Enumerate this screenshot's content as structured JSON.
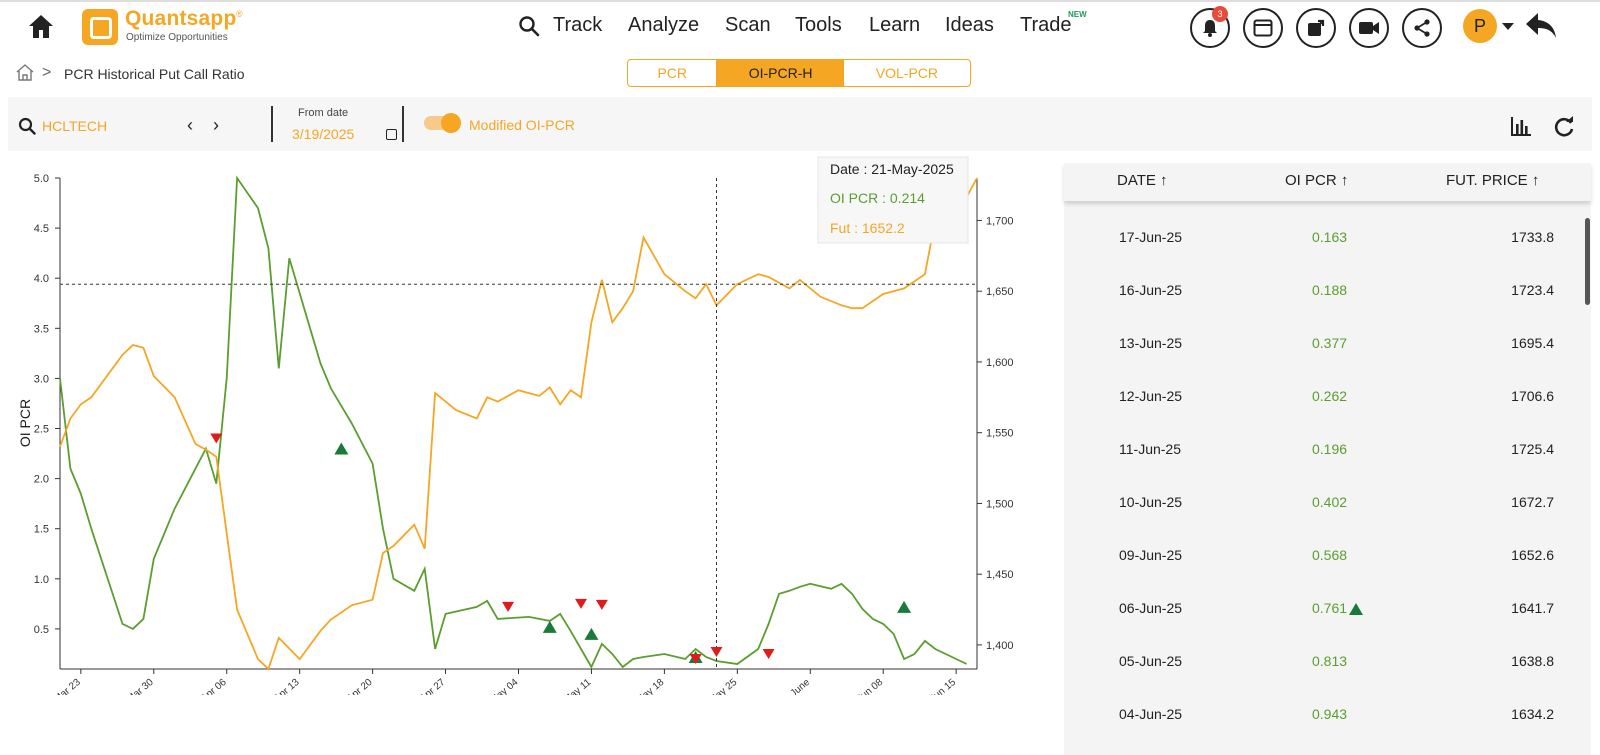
{
  "brand": {
    "title": "Quantsapp",
    "registered": "®",
    "tagline": "Optimize Opportunities"
  },
  "nav": {
    "items": [
      "Track",
      "Analyze",
      "Scan",
      "Tools",
      "Learn",
      "Ideas",
      "Trade"
    ],
    "new_badge": "NEW",
    "notification_count": "3",
    "avatar_letter": "P"
  },
  "breadcrumb": {
    "page": "PCR Historical Put Call Ratio",
    "separator": ">"
  },
  "tabs": [
    {
      "label": "PCR",
      "active": false
    },
    {
      "label": "OI-PCR-H",
      "active": true
    },
    {
      "label": "VOL-PCR",
      "active": false
    }
  ],
  "toolbar": {
    "symbol": "HCLTECH",
    "prev": "‹",
    "next": "›",
    "from_date_label": "From date",
    "from_date": "3/19/2025",
    "toggle_label": "Modified OI-PCR",
    "toggle_on": true
  },
  "tooltip": {
    "date": "Date : 21-May-2025",
    "oi_pcr": "OI PCR : 0.214",
    "fut": "Fut : 1652.2"
  },
  "colors": {
    "accent": "#f5a623",
    "pcr_line": "#5a9e2f",
    "buy_signal": "#1a7a3a",
    "sell_signal": "#e01b1b"
  },
  "chart_data": {
    "type": "line",
    "ylabel": "OI PCR",
    "left_ylim": [
      0.1,
      5.0
    ],
    "right_ylim": [
      1383,
      1730
    ],
    "left_ticks": [
      "5.0",
      "4.5",
      "4.0",
      "3.5",
      "3.0",
      "2.5",
      "2.0",
      "1.5",
      "1.0",
      "0.5"
    ],
    "right_ticks": [
      "1,700",
      "1,650",
      "1,600",
      "1,550",
      "1,500",
      "1,450",
      "1,400"
    ],
    "x_ticks": [
      "Mar 23",
      "Mar 30",
      "Apr 06",
      "Apr 13",
      "Apr 20",
      "Apr 27",
      "May 04",
      "May 11",
      "May 18",
      "May 25",
      "June",
      "Jun 08",
      "Jun 15"
    ],
    "x_tick_days": [
      0,
      7,
      14,
      21,
      28,
      35,
      42,
      49,
      56,
      63,
      70,
      77,
      84
    ],
    "x_range_days": [
      -2,
      86
    ],
    "series": [
      {
        "name": "OI PCR",
        "axis": "left",
        "days": [
          -2,
          -1,
          0,
          1,
          4,
          5,
          6,
          7,
          9,
          11,
          12,
          13,
          14,
          15,
          17,
          18,
          19,
          20,
          23,
          24,
          26,
          28,
          29,
          30,
          32,
          33,
          34,
          35,
          38,
          39,
          40,
          43,
          44,
          45,
          46,
          47,
          48,
          49,
          50,
          51,
          52,
          53,
          54,
          56,
          58,
          59,
          60,
          61,
          63,
          65,
          66,
          67,
          68,
          69,
          70,
          72,
          73,
          74,
          75,
          76,
          77,
          78,
          79,
          80,
          81,
          82,
          84,
          85
        ],
        "values": [
          3.0,
          2.1,
          1.85,
          1.5,
          0.55,
          0.5,
          0.6,
          1.2,
          1.7,
          2.1,
          2.3,
          1.95,
          3.0,
          5.0,
          4.7,
          4.3,
          3.1,
          4.2,
          3.15,
          2.9,
          2.55,
          2.15,
          1.5,
          1.0,
          0.88,
          1.1,
          0.3,
          0.65,
          0.72,
          0.78,
          0.6,
          0.62,
          0.6,
          0.58,
          0.65,
          0.48,
          0.3,
          0.12,
          0.35,
          0.25,
          0.12,
          0.2,
          0.22,
          0.25,
          0.2,
          0.3,
          0.22,
          0.18,
          0.15,
          0.3,
          0.55,
          0.85,
          0.88,
          0.92,
          0.95,
          0.9,
          0.95,
          0.85,
          0.7,
          0.6,
          0.55,
          0.45,
          0.2,
          0.25,
          0.38,
          0.3,
          0.2,
          0.15
        ]
      },
      {
        "name": "Fut",
        "axis": "right",
        "days": [
          -2,
          -1,
          0,
          1,
          4,
          5,
          6,
          7,
          9,
          11,
          12,
          13,
          15,
          17,
          18,
          19,
          21,
          23,
          24,
          26,
          28,
          29,
          30,
          32,
          33,
          34,
          35,
          36,
          38,
          39,
          40,
          42,
          43,
          44,
          45,
          46,
          47,
          48,
          49,
          50,
          51,
          52,
          53,
          54,
          56,
          58,
          59,
          60,
          61,
          63,
          65,
          66,
          67,
          68,
          69,
          71,
          73,
          74,
          75,
          77,
          79,
          81,
          82,
          83,
          84,
          86
        ],
        "values": [
          1540,
          1560,
          1570,
          1575,
          1605,
          1612,
          1610,
          1590,
          1575,
          1542,
          1538,
          1533,
          1425,
          1390,
          1383,
          1405,
          1390,
          1410,
          1418,
          1428,
          1432,
          1465,
          1470,
          1485,
          1468,
          1578,
          1572,
          1566,
          1560,
          1575,
          1572,
          1580,
          1578,
          1576,
          1582,
          1570,
          1580,
          1575,
          1628,
          1658,
          1628,
          1638,
          1650,
          1688,
          1662,
          1650,
          1645,
          1655,
          1640,
          1655,
          1662,
          1660,
          1656,
          1652,
          1658,
          1646,
          1640,
          1638,
          1638,
          1648,
          1652,
          1662,
          1700,
          1724,
          1703,
          1730
        ]
      }
    ],
    "buy_markers": [
      {
        "day": 25,
        "value": 2.3
      },
      {
        "day": 45,
        "value": 0.52
      },
      {
        "day": 49,
        "value": 0.45
      },
      {
        "day": 59,
        "value": 0.22
      },
      {
        "day": 79,
        "value": 0.72
      }
    ],
    "sell_markers": [
      {
        "day": 13,
        "value": 2.4
      },
      {
        "day": 41,
        "value": 0.72
      },
      {
        "day": 48,
        "value": 0.75
      },
      {
        "day": 50,
        "value": 0.74
      },
      {
        "day": 59,
        "value": 0.2
      },
      {
        "day": 61,
        "value": 0.27
      },
      {
        "day": 66,
        "value": 0.25
      }
    ],
    "crosshair": {
      "day": 61,
      "value": 3.94
    }
  },
  "table": {
    "headers": [
      "DATE ↑",
      "OI PCR ↑",
      "FUT. PRICE ↑"
    ],
    "rows": [
      {
        "date": "17-Jun-25",
        "oi_pcr": "0.163",
        "fut": "1733.8",
        "signal": ""
      },
      {
        "date": "16-Jun-25",
        "oi_pcr": "0.188",
        "fut": "1723.4",
        "signal": ""
      },
      {
        "date": "13-Jun-25",
        "oi_pcr": "0.377",
        "fut": "1695.4",
        "signal": ""
      },
      {
        "date": "12-Jun-25",
        "oi_pcr": "0.262",
        "fut": "1706.6",
        "signal": ""
      },
      {
        "date": "11-Jun-25",
        "oi_pcr": "0.196",
        "fut": "1725.4",
        "signal": ""
      },
      {
        "date": "10-Jun-25",
        "oi_pcr": "0.402",
        "fut": "1672.7",
        "signal": ""
      },
      {
        "date": "09-Jun-25",
        "oi_pcr": "0.568",
        "fut": "1652.6",
        "signal": ""
      },
      {
        "date": "06-Jun-25",
        "oi_pcr": "0.761",
        "fut": "1641.7",
        "signal": "buy"
      },
      {
        "date": "05-Jun-25",
        "oi_pcr": "0.813",
        "fut": "1638.8",
        "signal": ""
      },
      {
        "date": "04-Jun-25",
        "oi_pcr": "0.943",
        "fut": "1634.2",
        "signal": ""
      }
    ]
  }
}
